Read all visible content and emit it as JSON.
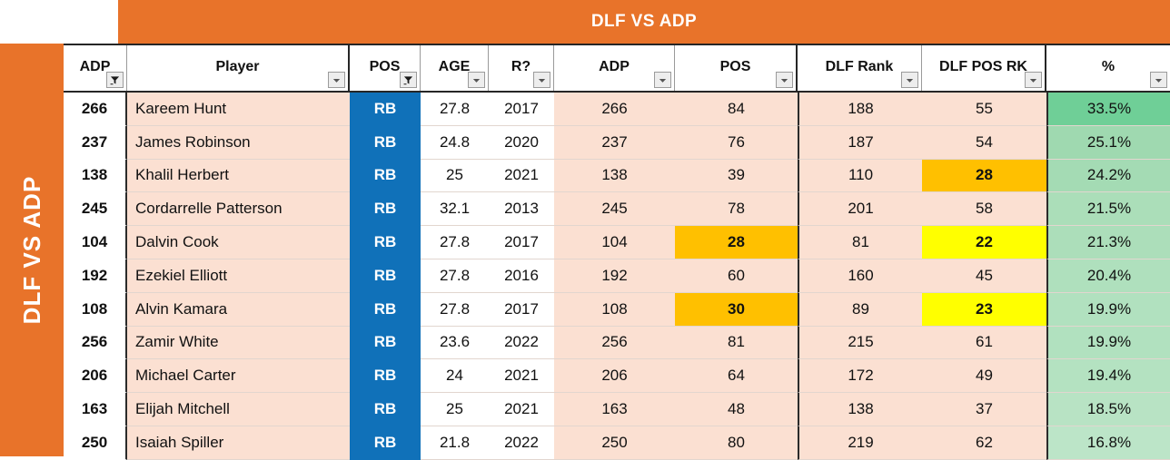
{
  "title": "DLF  VS ADP",
  "side_label": "DLF VS ADP",
  "colors": {
    "brand_orange": "#E8732A",
    "pos_blue": "#1071B9",
    "row_peach": "#FBE0D2",
    "highlight_orange": "#FFC000",
    "highlight_yellow": "#FFFF00",
    "pct_green_high": "#6FCF97",
    "pct_green_low": "#BCE3C4"
  },
  "columns": [
    {
      "label": "ADP",
      "icon": "filter-icon"
    },
    {
      "label": "Player",
      "icon": "chevron-down-icon"
    },
    {
      "label": "POS",
      "icon": "filter-icon"
    },
    {
      "label": "AGE",
      "icon": "chevron-down-icon"
    },
    {
      "label": "R?",
      "icon": "chevron-down-icon"
    },
    {
      "label": "ADP",
      "icon": "chevron-down-icon"
    },
    {
      "label": "POS",
      "icon": "chevron-down-icon"
    },
    {
      "label": "DLF Rank",
      "icon": "chevron-down-icon"
    },
    {
      "label": "DLF POS RK",
      "icon": "chevron-down-icon"
    },
    {
      "label": "%",
      "icon": "chevron-down-icon"
    }
  ],
  "rows": [
    {
      "adp_rank": "266",
      "player": "Kareem Hunt",
      "pos": "RB",
      "age": "27.8",
      "rookie_year": "2017",
      "adp": "266",
      "pos_rank": "84",
      "dlf_rank": "188",
      "dlf_pos_rk": "55",
      "pct": "33.5%",
      "pos_rank_hl": "none",
      "dlf_pos_rk_hl": "none",
      "pct_bg": "#6FCF97"
    },
    {
      "adp_rank": "237",
      "player": "James Robinson",
      "pos": "RB",
      "age": "24.8",
      "rookie_year": "2020",
      "adp": "237",
      "pos_rank": "76",
      "dlf_rank": "187",
      "dlf_pos_rk": "54",
      "pct": "25.1%",
      "pos_rank_hl": "none",
      "dlf_pos_rk_hl": "none",
      "pct_bg": "#9FD9B0"
    },
    {
      "adp_rank": "138",
      "player": "Khalil Herbert",
      "pos": "RB",
      "age": "25",
      "rookie_year": "2021",
      "adp": "138",
      "pos_rank": "39",
      "dlf_rank": "110",
      "dlf_pos_rk": "28",
      "pct": "24.2%",
      "pos_rank_hl": "none",
      "dlf_pos_rk_hl": "orange",
      "pct_bg": "#A4DBB4"
    },
    {
      "adp_rank": "245",
      "player": "Cordarrelle Patterson",
      "pos": "RB",
      "age": "32.1",
      "rookie_year": "2013",
      "adp": "245",
      "pos_rank": "78",
      "dlf_rank": "201",
      "dlf_pos_rk": "58",
      "pct": "21.5%",
      "pos_rank_hl": "none",
      "dlf_pos_rk_hl": "none",
      "pct_bg": "#ABDEB9"
    },
    {
      "adp_rank": "104",
      "player": "Dalvin Cook",
      "pos": "RB",
      "age": "27.8",
      "rookie_year": "2017",
      "adp": "104",
      "pos_rank": "28",
      "dlf_rank": "81",
      "dlf_pos_rk": "22",
      "pct": "21.3%",
      "pos_rank_hl": "orange",
      "dlf_pos_rk_hl": "yellow",
      "pct_bg": "#ACDEBA"
    },
    {
      "adp_rank": "192",
      "player": "Ezekiel Elliott",
      "pos": "RB",
      "age": "27.8",
      "rookie_year": "2016",
      "adp": "192",
      "pos_rank": "60",
      "dlf_rank": "160",
      "dlf_pos_rk": "45",
      "pct": "20.4%",
      "pos_rank_hl": "none",
      "dlf_pos_rk_hl": "none",
      "pct_bg": "#AFE0BD"
    },
    {
      "adp_rank": "108",
      "player": "Alvin Kamara",
      "pos": "RB",
      "age": "27.8",
      "rookie_year": "2017",
      "adp": "108",
      "pos_rank": "30",
      "dlf_rank": "89",
      "dlf_pos_rk": "23",
      "pct": "19.9%",
      "pos_rank_hl": "orange",
      "dlf_pos_rk_hl": "yellow",
      "pct_bg": "#B1E1BF"
    },
    {
      "adp_rank": "256",
      "player": "Zamir White",
      "pos": "RB",
      "age": "23.6",
      "rookie_year": "2022",
      "adp": "256",
      "pos_rank": "81",
      "dlf_rank": "215",
      "dlf_pos_rk": "61",
      "pct": "19.9%",
      "pos_rank_hl": "none",
      "dlf_pos_rk_hl": "none",
      "pct_bg": "#B1E1BF"
    },
    {
      "adp_rank": "206",
      "player": "Michael Carter",
      "pos": "RB",
      "age": "24",
      "rookie_year": "2021",
      "adp": "206",
      "pos_rank": "64",
      "dlf_rank": "172",
      "dlf_pos_rk": "49",
      "pct": "19.4%",
      "pos_rank_hl": "none",
      "dlf_pos_rk_hl": "none",
      "pct_bg": "#B4E2C1"
    },
    {
      "adp_rank": "163",
      "player": "Elijah Mitchell",
      "pos": "RB",
      "age": "25",
      "rookie_year": "2021",
      "adp": "163",
      "pos_rank": "48",
      "dlf_rank": "138",
      "dlf_pos_rk": "37",
      "pct": "18.5%",
      "pos_rank_hl": "none",
      "dlf_pos_rk_hl": "none",
      "pct_bg": "#B8E3C4"
    },
    {
      "adp_rank": "250",
      "player": "Isaiah Spiller",
      "pos": "RB",
      "age": "21.8",
      "rookie_year": "2022",
      "adp": "250",
      "pos_rank": "80",
      "dlf_rank": "219",
      "dlf_pos_rk": "62",
      "pct": "16.8%",
      "pos_rank_hl": "none",
      "dlf_pos_rk_hl": "none",
      "pct_bg": "#BCE5C8"
    }
  ]
}
